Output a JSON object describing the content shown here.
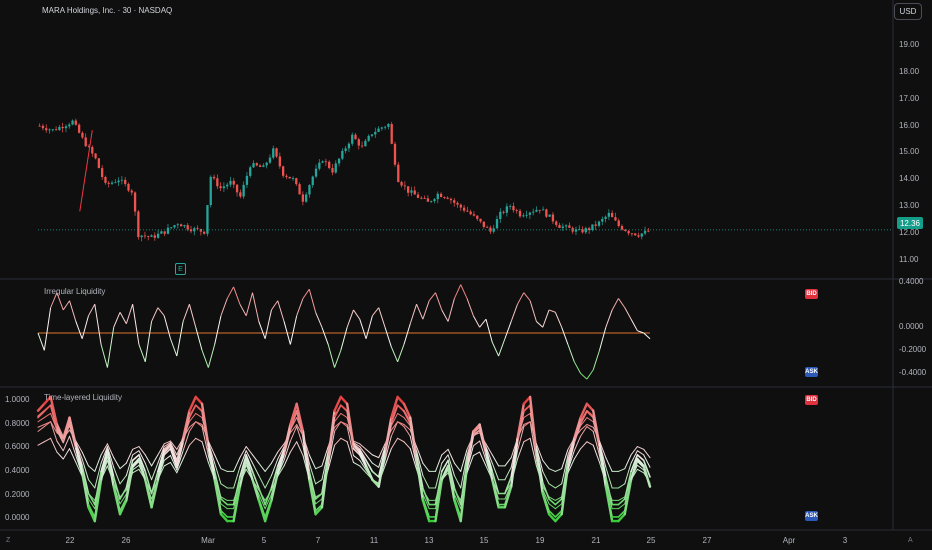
{
  "chart": {
    "title": "MARA Holdings, Inc. · 30 · NASDAQ",
    "currency_button": "USD",
    "last_price": "12.36",
    "earnings_icon_label": "E",
    "x_axis_labels": [
      "22",
      "26",
      "Mar",
      "5",
      "7",
      "11",
      "13",
      "15",
      "19",
      "21",
      "25",
      "27",
      "Apr",
      "3"
    ],
    "corner_left": "Z",
    "corner_right": "A",
    "colors": {
      "background": "#0f0f0f",
      "up": "#26a69a",
      "down": "#ef5350",
      "trendline": "#f23645",
      "zero_line": "#e0752d"
    }
  },
  "panes": {
    "price": {
      "y_labels": [
        "19.00",
        "18.00",
        "17.00",
        "16.00",
        "15.00",
        "14.00",
        "13.00",
        "12.00",
        "11.00"
      ]
    },
    "irregular": {
      "label": "Irregular Liquidity",
      "y_labels": [
        "0.4000",
        "0.0000",
        "-0.2000",
        "-0.4000"
      ],
      "bid_tag": "BID",
      "ask_tag": "ASK"
    },
    "time_layered": {
      "label": "Time-layered Liquidity",
      "y_labels": [
        "1.0000",
        "0.8000",
        "0.6000",
        "0.4000",
        "0.2000",
        "0.0000"
      ],
      "bid_tag": "BID",
      "ask_tag": "ASK"
    }
  },
  "chart_data": {
    "type": "line",
    "symbol": "MARA",
    "price_axis": {
      "ylim": [
        10.7,
        19.6
      ]
    },
    "price_anchors": [
      [
        0,
        15.95
      ],
      [
        4,
        15.8
      ],
      [
        8,
        16.0
      ],
      [
        10,
        16.1
      ],
      [
        13,
        15.5
      ],
      [
        17,
        14.8
      ],
      [
        20,
        13.9
      ],
      [
        24,
        14.1
      ],
      [
        28,
        13.7
      ],
      [
        30,
        12.2
      ],
      [
        34,
        12.1
      ],
      [
        38,
        12.3
      ],
      [
        42,
        12.6
      ],
      [
        46,
        12.4
      ],
      [
        50,
        12.3
      ],
      [
        52,
        14.2
      ],
      [
        55,
        13.8
      ],
      [
        58,
        14.0
      ],
      [
        61,
        13.5
      ],
      [
        64,
        14.6
      ],
      [
        68,
        14.5
      ],
      [
        71,
        15.1
      ],
      [
        74,
        14.3
      ],
      [
        77,
        14.1
      ],
      [
        80,
        13.4
      ],
      [
        83,
        14.2
      ],
      [
        86,
        14.8
      ],
      [
        89,
        14.4
      ],
      [
        92,
        15.0
      ],
      [
        95,
        15.6
      ],
      [
        98,
        15.2
      ],
      [
        101,
        15.7
      ],
      [
        104,
        15.9
      ],
      [
        106,
        16.0
      ],
      [
        107,
        15.3
      ],
      [
        109,
        14.1
      ],
      [
        112,
        13.7
      ],
      [
        115,
        13.5
      ],
      [
        118,
        13.3
      ],
      [
        121,
        13.6
      ],
      [
        124,
        13.5
      ],
      [
        127,
        13.2
      ],
      [
        130,
        13.0
      ],
      [
        134,
        12.6
      ],
      [
        137,
        12.3
      ],
      [
        140,
        12.9
      ],
      [
        143,
        13.2
      ],
      [
        146,
        12.9
      ],
      [
        149,
        13.0
      ],
      [
        152,
        13.1
      ],
      [
        155,
        12.8
      ],
      [
        158,
        12.5
      ],
      [
        161,
        12.4
      ],
      [
        164,
        12.3
      ],
      [
        167,
        12.4
      ],
      [
        170,
        12.6
      ],
      [
        173,
        12.9
      ],
      [
        176,
        12.5
      ],
      [
        179,
        12.3
      ],
      [
        182,
        12.2
      ],
      [
        185,
        12.3
      ]
    ],
    "trendline": {
      "from": [
        12.2,
        13.0
      ],
      "to": [
        16.0,
        15.8
      ]
    },
    "irregular_liquidity": {
      "ylim": [
        -0.46,
        0.46
      ],
      "values": [
        0.0,
        -0.15,
        0.22,
        0.35,
        0.2,
        0.28,
        0.1,
        -0.05,
        0.15,
        0.25,
        -0.1,
        -0.3,
        0.05,
        0.18,
        0.08,
        0.25,
        -0.1,
        -0.25,
        0.1,
        0.22,
        0.15,
        -0.05,
        -0.2,
        0.1,
        0.25,
        0.05,
        -0.15,
        -0.3,
        -0.1,
        0.15,
        0.3,
        0.4,
        0.25,
        0.15,
        0.35,
        0.1,
        -0.05,
        0.2,
        0.28,
        0.1,
        -0.1,
        0.15,
        0.3,
        0.38,
        0.18,
        0.05,
        -0.1,
        -0.3,
        -0.15,
        0.05,
        0.2,
        0.12,
        -0.05,
        0.15,
        0.22,
        0.05,
        -0.12,
        -0.25,
        -0.1,
        0.08,
        0.25,
        0.12,
        0.28,
        0.35,
        0.2,
        0.1,
        0.3,
        0.42,
        0.3,
        0.15,
        0.05,
        0.12,
        -0.08,
        -0.2,
        -0.05,
        0.1,
        0.25,
        0.35,
        0.28,
        0.1,
        0.05,
        0.2,
        0.18,
        0.05,
        -0.1,
        -0.25,
        -0.35,
        -0.4,
        -0.32,
        -0.15,
        0.05,
        0.2,
        0.3,
        0.22,
        0.12,
        0.02,
        0.0,
        -0.05
      ]
    },
    "time_layered_liquidity": {
      "ylim": [
        0,
        1
      ],
      "layers": 7,
      "base_values": [
        0.85,
        0.9,
        0.95,
        0.75,
        0.65,
        0.8,
        0.6,
        0.4,
        0.15,
        0.05,
        0.35,
        0.55,
        0.3,
        0.1,
        0.2,
        0.45,
        0.5,
        0.35,
        0.15,
        0.35,
        0.55,
        0.6,
        0.45,
        0.65,
        0.85,
        0.95,
        0.9,
        0.6,
        0.35,
        0.1,
        0.05,
        0.05,
        0.3,
        0.5,
        0.35,
        0.2,
        0.05,
        0.2,
        0.4,
        0.55,
        0.75,
        0.9,
        0.7,
        0.35,
        0.1,
        0.15,
        0.5,
        0.85,
        0.95,
        0.9,
        0.6,
        0.55,
        0.45,
        0.35,
        0.3,
        0.55,
        0.8,
        0.95,
        0.9,
        0.8,
        0.5,
        0.2,
        0.05,
        0.05,
        0.35,
        0.45,
        0.2,
        0.05,
        0.45,
        0.7,
        0.75,
        0.55,
        0.35,
        0.15,
        0.15,
        0.3,
        0.65,
        0.9,
        0.95,
        0.55,
        0.25,
        0.1,
        0.05,
        0.1,
        0.45,
        0.65,
        0.8,
        0.9,
        0.85,
        0.6,
        0.3,
        0.05,
        0.05,
        0.1,
        0.35,
        0.5,
        0.45,
        0.3
      ]
    }
  }
}
